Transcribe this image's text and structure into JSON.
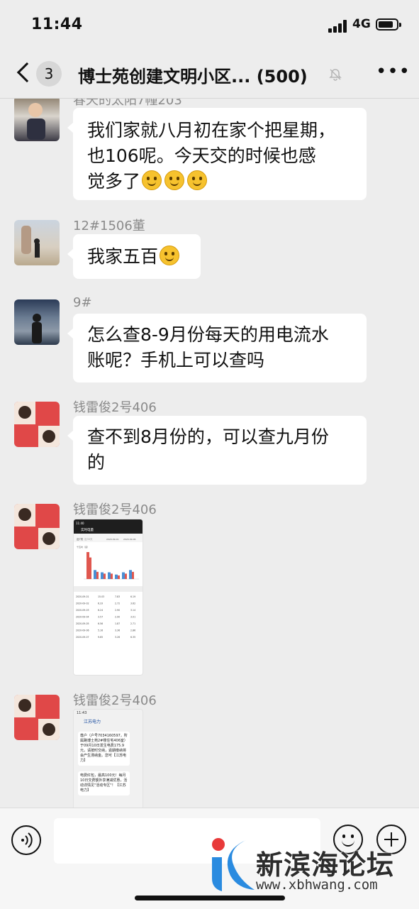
{
  "status_bar": {
    "time": "11:44",
    "network": "4G"
  },
  "header": {
    "unread_count": "3",
    "title": "博士苑创建文明小区... (500)"
  },
  "messages": [
    {
      "sender": "春天的太阳7幢203",
      "lines": [
        "我们家就八月初在家个把星期，",
        "也106呢。今天交的时候也感",
        "觉多了"
      ]
    },
    {
      "sender": "12#1506董",
      "text": "我家五百"
    },
    {
      "sender": "9#",
      "lines": [
        "怎么查8-9月份每天的用电流水",
        "账呢？手机上可以查吗"
      ]
    },
    {
      "sender": "钱雷俊2号406",
      "lines": [
        "查不到8月份的，可以查九月份",
        "的"
      ]
    },
    {
      "sender": "钱雷俊2号406",
      "image": "电量截图"
    },
    {
      "sender": "钱雷俊2号406",
      "image": "江苏电力截图"
    }
  ],
  "screenshot1": {
    "time": "11:40",
    "title": "实时电量",
    "tab": "近7天",
    "tab2": "近30天",
    "date_from": "2020-09-01",
    "date_to": "2020-09-06",
    "unit": "千瓦时（度）",
    "bars": [
      12,
      4,
      3,
      3,
      2,
      3,
      4
    ],
    "bar_colors": [
      "#e0574f",
      "#4a8fd4"
    ],
    "table_rows": [
      [
        "2020-09-01",
        "15.03",
        "7.83",
        "6.19"
      ],
      [
        "2020-09-02",
        "6.33",
        "2.72",
        "3.62"
      ],
      [
        "2020-09-03",
        "6.24",
        "2.90",
        "3.14"
      ],
      [
        "2020-09-04",
        "3.57",
        "2.90",
        "3.01"
      ],
      [
        "2020-09-05",
        "6.56",
        "1.87",
        "2.71"
      ],
      [
        "2020-09-06",
        "5.16",
        "3.36",
        "2.86"
      ],
      [
        "2020-09-07",
        "9.65",
        "3.26",
        "6.35"
      ]
    ]
  },
  "screenshot2": {
    "time": "11:43",
    "app": "江苏电力",
    "msg1": "尊户（户号7034160597，所属路博士苑2#楼住宅406室）于09月10日发生电费175.9元，请按时交纳，逾期缴纳将会产生滞纳金。您可【江苏电力】",
    "msg2": "电费红包，最高100元！每月10日交费额外享满减优惠，活动详情见\"活动专区\"！【江苏电力】"
  },
  "watermark": {
    "name": "新滨海论坛",
    "url": "www.xbhwang.com"
  }
}
